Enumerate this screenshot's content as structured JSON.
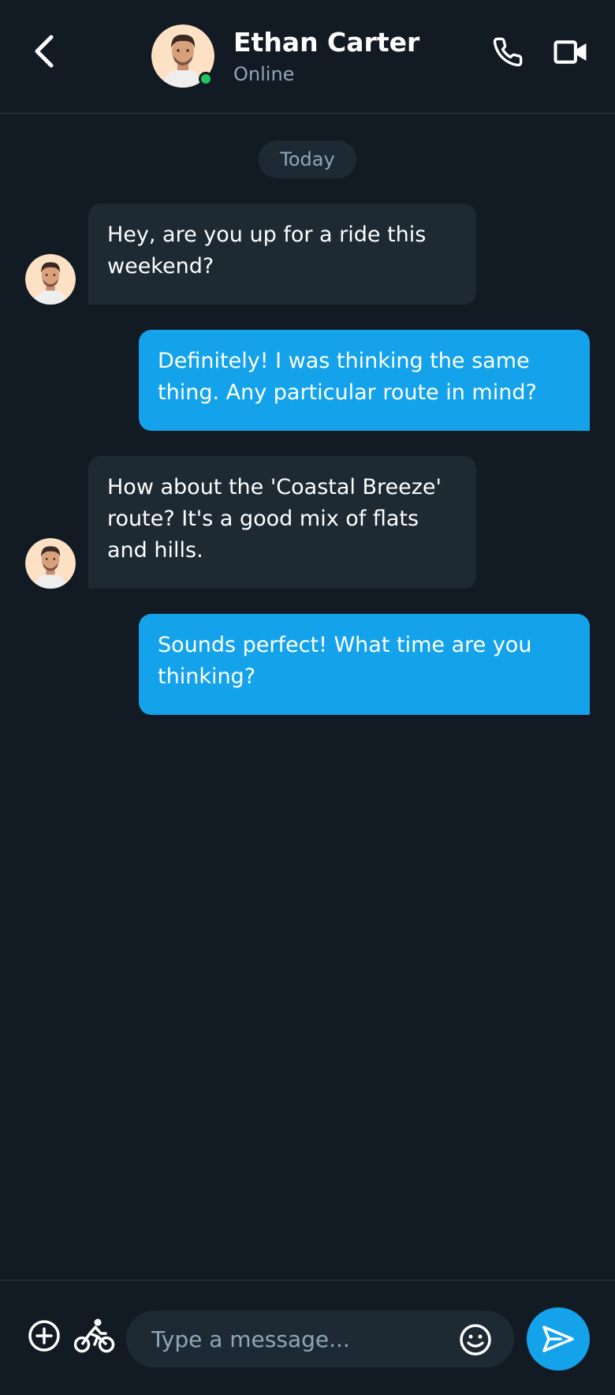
{
  "header": {
    "contact_name": "Ethan Carter",
    "contact_status": "Online"
  },
  "conversation": {
    "date_label": "Today",
    "messages": [
      {
        "direction": "incoming",
        "text": "Hey, are you up for a ride this weekend?"
      },
      {
        "direction": "outgoing",
        "text": "Definitely! I was thinking the same thing. Any particular route in mind?"
      },
      {
        "direction": "incoming",
        "text": "How about the 'Coastal Breeze' route? It's a good mix of flats and hills."
      },
      {
        "direction": "outgoing",
        "text": "Sounds perfect! What time are you thinking?"
      }
    ]
  },
  "composer": {
    "placeholder": "Type a message...",
    "value": ""
  },
  "icons": {
    "back": "chevron-left-icon",
    "call": "phone-icon",
    "video": "video-camera-icon",
    "add": "plus-circle-icon",
    "bike": "bicycle-icon",
    "emoji": "smiley-icon",
    "send": "send-icon"
  },
  "colors": {
    "background": "#121b23",
    "incoming_bubble": "#1e2a33",
    "outgoing_bubble": "#14a3ea",
    "online_dot": "#22c55e",
    "muted_text": "#8fa6b5"
  }
}
